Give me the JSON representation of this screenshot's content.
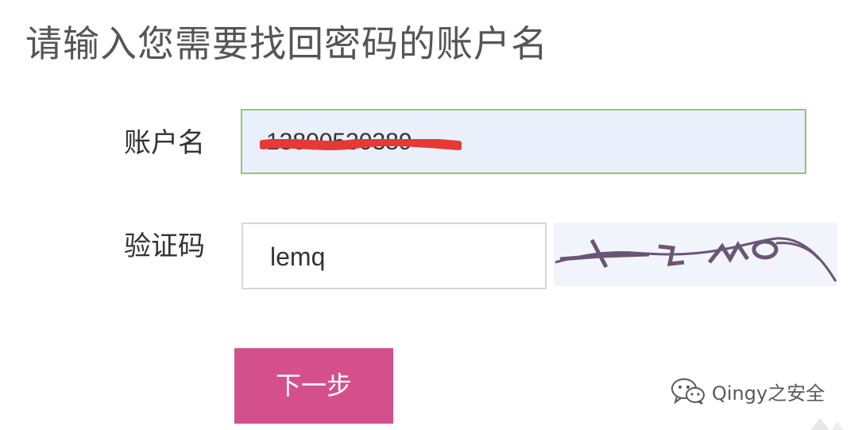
{
  "title": "请输入您需要找回密码的账户名",
  "form": {
    "account_label": "账户名",
    "account_value": "13800530389",
    "captcha_label": "验证码",
    "captcha_value": "lemq",
    "captcha_image_text": "lemq",
    "next_button_label": "下一步"
  },
  "watermark": {
    "text": "Qingy之安全",
    "icon": "wechat-icon"
  },
  "colors": {
    "next_button": "#d4508c",
    "account_border": "#8fc970",
    "account_background": "#eaf0fb",
    "redaction": "#e53935",
    "captcha_ink": "#6b5577"
  }
}
